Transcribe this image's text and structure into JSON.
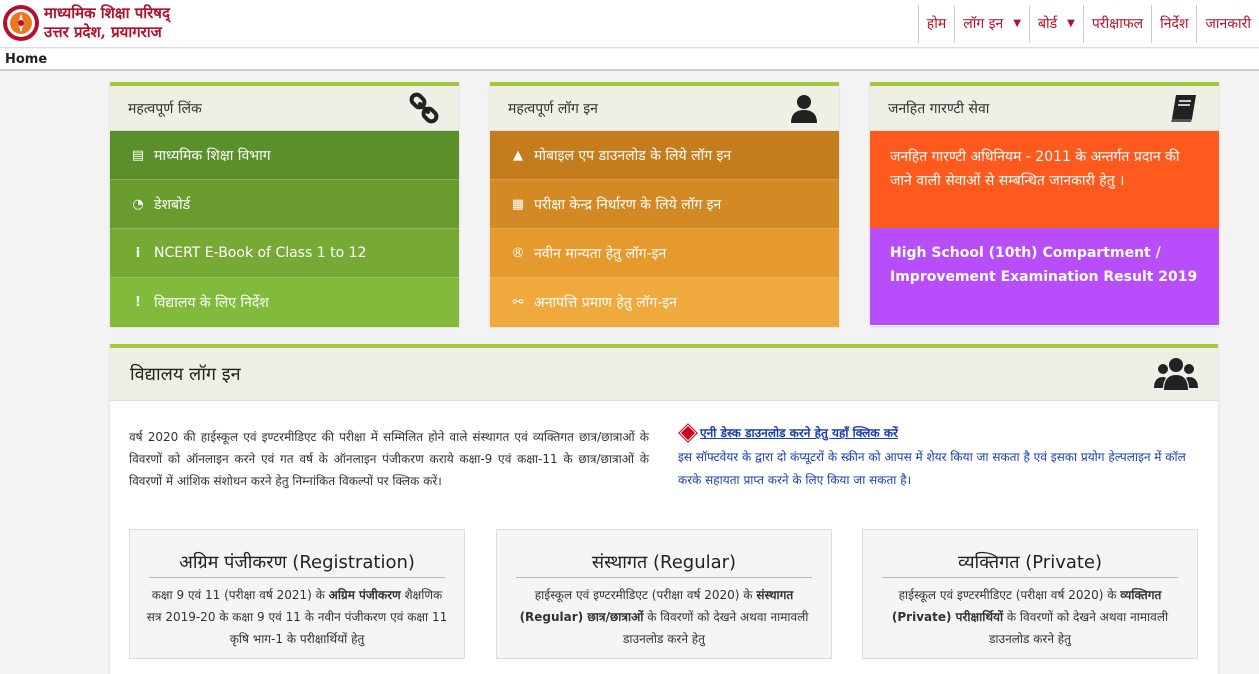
{
  "header": {
    "brand_line1": "माध्यमिक शिक्षा परिषद्",
    "brand_line2": "उत्तर प्रदेश, प्रयागराज",
    "nav": [
      {
        "label": "होम",
        "caret": false
      },
      {
        "label": "लॉग इन",
        "caret": true
      },
      {
        "label": "बोर्ड",
        "caret": true
      },
      {
        "label": "परीक्षाफल",
        "caret": false
      },
      {
        "label": "निर्देश",
        "caret": false
      },
      {
        "label": "जानकारी",
        "caret": false
      }
    ]
  },
  "breadcrumb": {
    "current": "Home"
  },
  "important_links": {
    "title": "महत्वपूर्ण लिंक",
    "items": [
      {
        "label": "माध्यमिक शिक्षा विभाग",
        "icon": "document-icon"
      },
      {
        "label": "डेशबोर्ड",
        "icon": "dashboard-icon"
      },
      {
        "label": "NCERT E-Book of Class 1 to 12",
        "icon": "info-icon"
      },
      {
        "label": "विद्यालय के लिए निर्देश",
        "icon": "exclamation-icon"
      }
    ]
  },
  "important_logins": {
    "title": "महत्वपूर्ण लॉग इन",
    "items": [
      {
        "label": "मोबाइल एप डाउनलोड के लिये लॉग इन",
        "icon": "android-icon"
      },
      {
        "label": "परीक्षा केन्द्र निर्धारण के लिये लॉग इन",
        "icon": "building-icon"
      },
      {
        "label": "नवीन मान्यता हेतु लॉग-इन",
        "icon": "registered-icon"
      },
      {
        "label": "अनापत्ति प्रमाण हेतु लॉग-इन",
        "icon": "unlink-icon"
      }
    ]
  },
  "public_service": {
    "title": "जनहित गारण्टी सेवा",
    "item1": "जनहित गारण्टी अधिनियम - 2011 के अन्तर्गत प्रदान की जाने वाली सेवाओं से सम्बन्धित जानकारी हेतु ।",
    "item2": "High School (10th) Compartment / Improvement Examination Result 2019"
  },
  "school_login": {
    "title": "विद्यालय लॉग इन",
    "intro": "वर्ष 2020 की हाईस्कूल एवं इण्टरमीडिएट की परीक्षा में सम्मिलित होने वाले संस्थागत एवं व्यक्तिगत छात्र/छात्राओं के विवरणों को ऑनलाइन करने एवं गत वर्ष के ऑनलाइन पंजीकरण कराये कक्षा-9 एवं कक्षा-11 के छात्र/छात्राओं के विवरणों में आंशिक संशोधन करने हेतु निम्नांकित विकल्पों पर क्लिक करें।",
    "anydesk_link": "एनी डेस्क डाउनलोड करने हेतु यहाँ क्लिक करें",
    "anydesk_desc": "इस सॉफ्टवेयर के द्वारा दो कंप्यूटरों के स्क्रीन को आपस में शेयर किया जा सकता है एवं इसका प्रयोग हेल्पलाइन में कॉल करके सहायता प्राप्त करने के लिए किया जा सकता है।",
    "cards": [
      {
        "title": "अग्रिम पंजीकरण (Registration)",
        "pre": "कक्षा 9 एवं 11 (परीक्षा वर्ष 2021) के ",
        "bold": "अग्रिम पंजीकरण",
        "post": " शैक्षणिक सत्र 2019-20 के कक्षा 9 एवं 11 के नवीन पंजीकरण एवं कक्षा 11 कृषि भाग-1 के परीक्षार्थियों हेतु"
      },
      {
        "title": "संस्थागत (Regular)",
        "pre": "हाईस्कूल एवं इण्टरमीडिएट (परीक्षा वर्ष 2020) के ",
        "bold": "संस्थागत (Regular) छात्र/छात्राओं",
        "post": " के विवरणों को देखने अथवा नामावली डाउनलोड करने हेतु"
      },
      {
        "title": "व्यक्तिगत (Private)",
        "pre": "हाईस्कूल एवं इण्टरमीडिएट (परीक्षा वर्ष 2020) के ",
        "bold": "व्यक्तिगत (Private) परीक्षार्थियों",
        "post": " के विवरणों को देखने अथवा नामावली डाउनलोड करने हेतु"
      }
    ]
  }
}
